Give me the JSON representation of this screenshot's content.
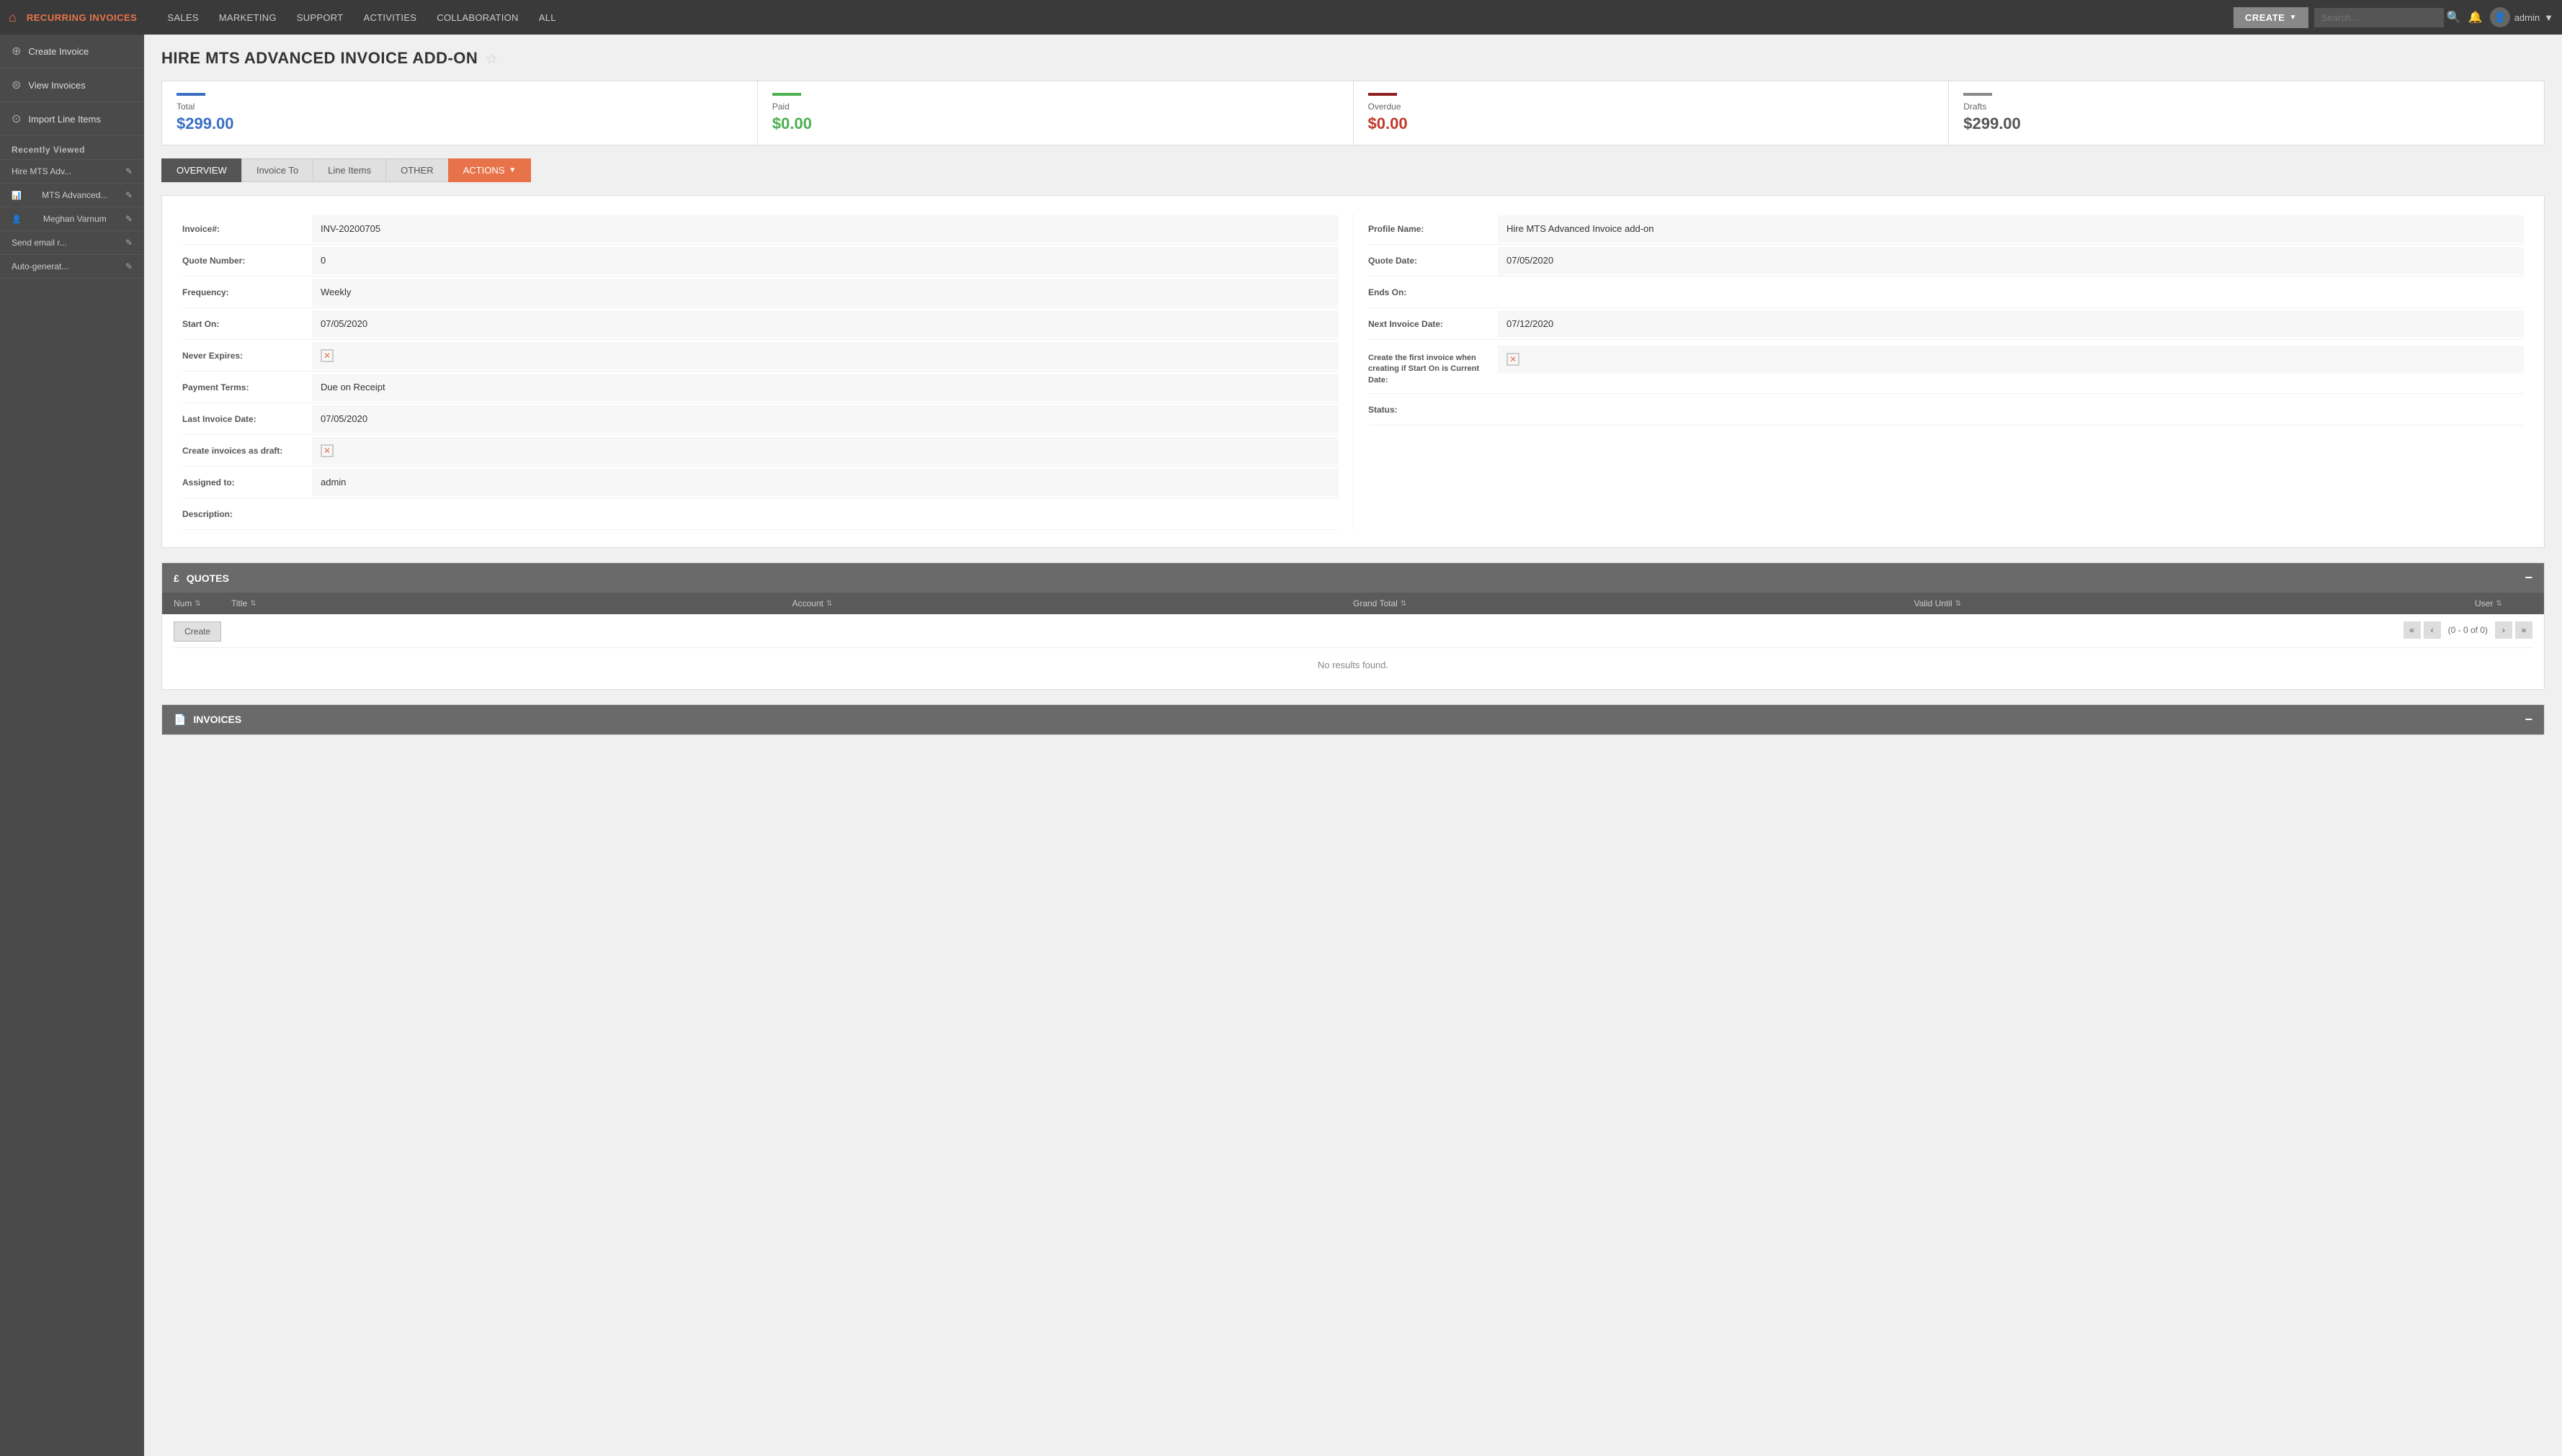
{
  "app": {
    "title": "RECURRING INVOICES"
  },
  "nav": {
    "items": [
      {
        "label": "SALES"
      },
      {
        "label": "MARKETING"
      },
      {
        "label": "SUPPORT"
      },
      {
        "label": "ACTIVITIES"
      },
      {
        "label": "COLLABORATION"
      },
      {
        "label": "ALL"
      }
    ]
  },
  "topbar": {
    "create_label": "CREATE",
    "search_placeholder": "Search...",
    "user_label": "admin"
  },
  "sidebar": {
    "items": [
      {
        "label": "Create Invoice",
        "icon": "➕"
      },
      {
        "label": "View Invoices",
        "icon": "⬇"
      },
      {
        "label": "Import Line Items",
        "icon": "⬇"
      }
    ],
    "recently_viewed_label": "Recently Viewed",
    "recent_items": [
      {
        "label": "Hire MTS Adv..."
      },
      {
        "label": "MTS Advanced..."
      },
      {
        "label": "Meghan Varnum"
      },
      {
        "label": "Send email r..."
      },
      {
        "label": "Auto-generat..."
      }
    ]
  },
  "page": {
    "title": "HIRE MTS ADVANCED INVOICE ADD-ON"
  },
  "stats": [
    {
      "label": "Total",
      "value": "$299.00",
      "color": "blue",
      "bar": "blue"
    },
    {
      "label": "Paid",
      "value": "$0.00",
      "color": "green",
      "bar": "green"
    },
    {
      "label": "Overdue",
      "value": "$0.00",
      "color": "red",
      "bar": "red"
    },
    {
      "label": "Drafts",
      "value": "$299.00",
      "color": "gray",
      "bar": "gray"
    }
  ],
  "tabs": [
    {
      "label": "OVERVIEW",
      "active": true
    },
    {
      "label": "Invoice To",
      "active": false
    },
    {
      "label": "Line Items",
      "active": false
    },
    {
      "label": "OTHER",
      "active": false
    },
    {
      "label": "ACTIONS",
      "active": false,
      "actions": true
    }
  ],
  "form": {
    "left_fields": [
      {
        "label": "Invoice#:",
        "value": "INV-20200705"
      },
      {
        "label": "Quote Number:",
        "value": "0"
      },
      {
        "label": "Frequency:",
        "value": "Weekly"
      },
      {
        "label": "Start On:",
        "value": "07/05/2020"
      },
      {
        "label": "Never Expires:",
        "value": "checkbox"
      },
      {
        "label": "Payment Terms:",
        "value": "Due on Receipt"
      },
      {
        "label": "Last Invoice Date:",
        "value": "07/05/2020"
      },
      {
        "label": "Create invoices as draft:",
        "value": "checkbox"
      },
      {
        "label": "Assigned to:",
        "value": "admin"
      },
      {
        "label": "Description:",
        "value": ""
      }
    ],
    "right_fields": [
      {
        "label": "Profile Name:",
        "value": "Hire MTS Advanced Invoice add-on"
      },
      {
        "label": "Quote Date:",
        "value": "07/05/2020"
      },
      {
        "label": "Ends On:",
        "value": ""
      },
      {
        "label": "Next Invoice Date:",
        "value": "07/12/2020"
      },
      {
        "label": "Create the first invoice when creating if Start On is Current Date:",
        "value": "checkbox"
      },
      {
        "label": "Status:",
        "value": ""
      }
    ]
  },
  "quotes_section": {
    "title": "QUOTES",
    "icon": "£",
    "columns": [
      "Num",
      "Title",
      "Account",
      "Grand Total",
      "Valid Until",
      "User"
    ],
    "create_label": "Create",
    "no_results": "No results found.",
    "pagination": "(0 - 0 of 0)"
  },
  "invoices_section": {
    "title": "INVOICES",
    "icon": "📄"
  }
}
